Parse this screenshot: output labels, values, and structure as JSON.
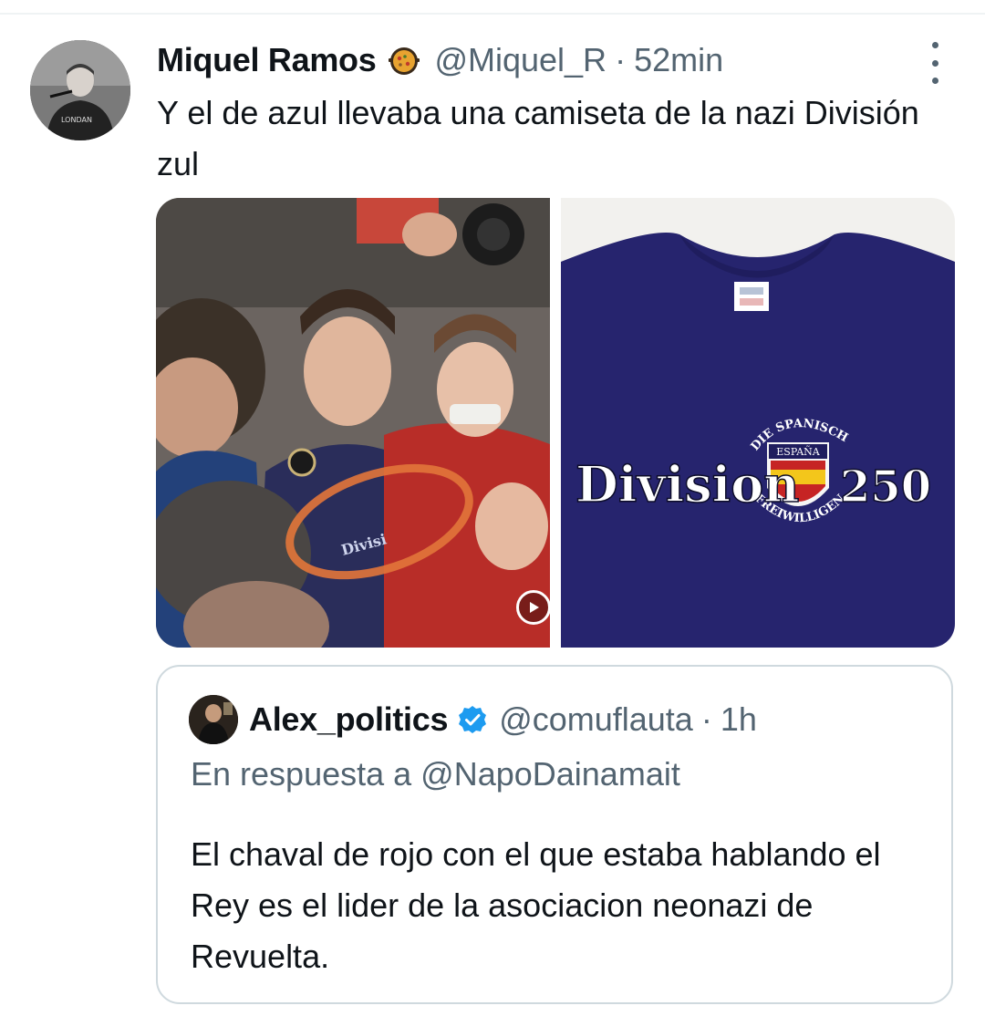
{
  "tweet": {
    "display_name": "Miquel Ramos",
    "badge_emoji_name": "paella-pan-emoji",
    "handle": "@Miquel_R",
    "separator": "·",
    "time": "52min",
    "text": "Y el de azul llevaba una camiseta de la nazi División zul"
  },
  "media": {
    "left_name": "crowd-video-thumbnail",
    "right_name": "blue-tshirt-photo",
    "shirt_print": {
      "word_left": "Division",
      "number": "250",
      "arc_top": "DIE SPANISCHEN",
      "arc_bottom": "FREIWILLIGEN",
      "shield_text": "ESPAÑA"
    },
    "has_video_badge": true
  },
  "quoted_tweet": {
    "display_name": "Alex_politics",
    "handle": "@comuflauta",
    "separator": "·",
    "time": "1h",
    "reply_context": "En respuesta a @NapoDainamait",
    "text": "El chaval de rojo con el que estaba hablando el Rey es el lider de la asociacion neonazi de Revuelta."
  },
  "colors": {
    "text_primary": "#0f1419",
    "text_secondary": "#536471",
    "border": "#cfd9de",
    "verified_blue": "#1d9bf0",
    "shirt_navy": "#26246e",
    "highlight_orange": "#e2763a"
  }
}
